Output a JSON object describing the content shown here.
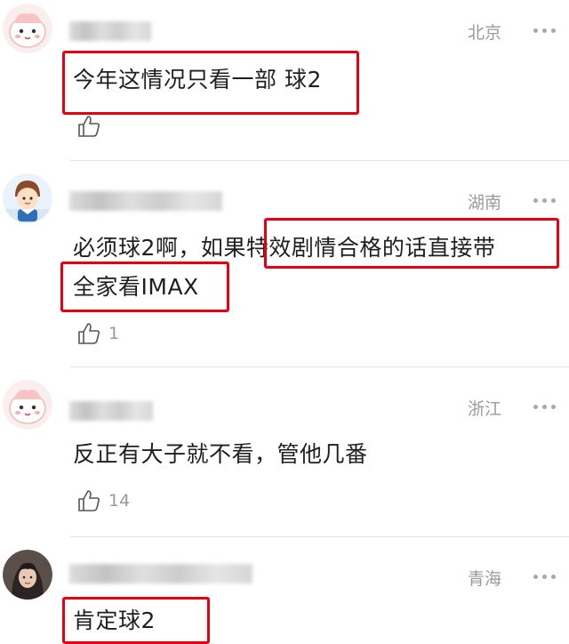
{
  "comments": [
    {
      "avatar": "pink-cartoon-face",
      "location": "北京",
      "text": "今年这情况只看一部 球2",
      "likes": ""
    },
    {
      "avatar": "cartoon-character",
      "location": "湖南",
      "text_line1_a": "必须球2啊，如果",
      "text_line1_b": "特效剧情合格的话直接带",
      "text_line2": "全家看IMAX",
      "likes": "1"
    },
    {
      "avatar": "pink-cartoon-face",
      "location": "浙江",
      "text": "反正有大子就不看，管他几番",
      "likes": "14"
    },
    {
      "avatar": "portrait-photo",
      "location": "青海",
      "text": "肯定球2",
      "likes": ""
    }
  ],
  "icons": {
    "more": "more-dots-icon",
    "like": "thumbs-up-icon"
  },
  "colors": {
    "highlight_border": "#e60012",
    "meta_text": "#9a9a9a"
  }
}
